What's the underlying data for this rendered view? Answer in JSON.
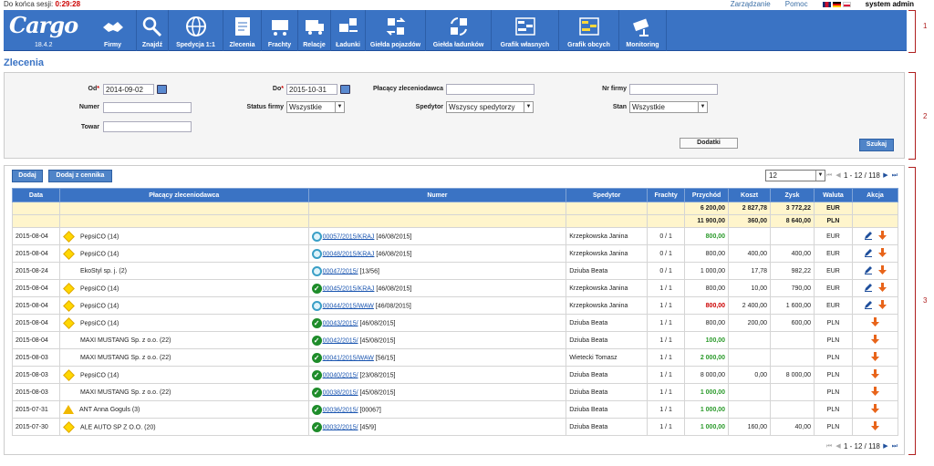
{
  "session": {
    "label": "Do końca sesji:",
    "time": "0:29:28"
  },
  "top_links": {
    "manage": "Zarządzanie",
    "help": "Pomoc",
    "user": "system admin"
  },
  "brand": {
    "name": "Cargo",
    "version": "18.4.2"
  },
  "nav": [
    {
      "label": "Firmy",
      "icon": "handshake-icon"
    },
    {
      "label": "Znajdź",
      "icon": "magnifier-icon"
    },
    {
      "label": "Spedycja 1:1",
      "icon": "globe-icon"
    },
    {
      "label": "Zlecenia",
      "icon": "document-icon"
    },
    {
      "label": "Frachty",
      "icon": "cart-icon"
    },
    {
      "label": "Relacje",
      "icon": "truck-icon"
    },
    {
      "label": "Ładunki",
      "icon": "forklift-icon"
    },
    {
      "label": "Giełda pojazdów",
      "icon": "vehicle-exchange-icon"
    },
    {
      "label": "Giełda ładunków",
      "icon": "cargo-exchange-icon"
    },
    {
      "label": "Grafik własnych",
      "icon": "schedule-icon"
    },
    {
      "label": "Grafik obcych",
      "icon": "schedule-yellow-icon"
    },
    {
      "label": "Monitoring",
      "icon": "camera-icon"
    }
  ],
  "annotations": [
    "1",
    "2",
    "3"
  ],
  "page_title": "Zlecenia",
  "filters": {
    "od_label": "Od",
    "od_value": "2014-09-02",
    "do_label": "Do",
    "do_value": "2015-10-31",
    "platnik_label": "Płacący zleceniodawca",
    "platnik_value": "",
    "nr_firmy_label": "Nr firmy",
    "nr_firmy_value": "",
    "numer_label": "Numer",
    "numer_value": "",
    "status_label": "Status firmy",
    "status_value": "Wszystkie",
    "spedytor_label": "Spedytor",
    "spedytor_value": "Wszyscy spedytorzy",
    "stan_label": "Stan",
    "stan_value": "Wszystkie",
    "towar_label": "Towar",
    "towar_value": "",
    "dodatki": "Dodatki",
    "szukaj": "Szukaj"
  },
  "buttons": {
    "dodaj": "Dodaj",
    "dodaj_cennik": "Dodaj z cennika"
  },
  "pagination": {
    "per_page": "12",
    "range": "1 - 12 / 118"
  },
  "table": {
    "headers": [
      "Data",
      "Płacący zleceniodawca",
      "Numer",
      "Spedytor",
      "Frachty",
      "Przychód",
      "Koszt",
      "Zysk",
      "Waluta",
      "Akcja"
    ],
    "sums": [
      {
        "przychod": "6 200,00",
        "koszt": "2 827,78",
        "zysk": "3 772,22",
        "waluta": "EUR"
      },
      {
        "przychod": "11 900,00",
        "koszt": "360,00",
        "zysk": "8 640,00",
        "waluta": "PLN"
      }
    ],
    "rows": [
      {
        "data": "2015-08-04",
        "flag": "diamond",
        "platnik": "PepsiCO (14)",
        "status": "refresh",
        "numer": "00057/2015/KRAJ",
        "numer_extra": "[46/08/2015]",
        "spedytor": "Krzepkowska Janina",
        "frachty": "0 / 1",
        "przychod": "800,00",
        "przychod_style": "green",
        "koszt": "",
        "zysk": "",
        "waluta": "EUR",
        "edit": true
      },
      {
        "data": "2015-08-04",
        "flag": "diamond",
        "platnik": "PepsiCO (14)",
        "status": "refresh",
        "numer": "00048/2015/KRAJ",
        "numer_extra": "[46/08/2015]",
        "spedytor": "Krzepkowska Janina",
        "frachty": "0 / 1",
        "przychod": "800,00",
        "przychod_style": "",
        "koszt": "400,00",
        "zysk": "400,00",
        "waluta": "EUR",
        "edit": true
      },
      {
        "data": "2015-08-24",
        "flag": "",
        "platnik": "EkoStyl sp. j. (2)",
        "status": "refresh",
        "numer": "00047/2015/",
        "numer_extra": "[13/56]",
        "spedytor": "Dziuba Beata",
        "frachty": "0 / 1",
        "przychod": "1 000,00",
        "przychod_style": "",
        "koszt": "17,78",
        "zysk": "982,22",
        "waluta": "EUR",
        "edit": true
      },
      {
        "data": "2015-08-04",
        "flag": "diamond",
        "platnik": "PepsiCO (14)",
        "status": "check",
        "numer": "00045/2015/KRAJ",
        "numer_extra": "[46/08/2015]",
        "spedytor": "Krzepkowska Janina",
        "frachty": "1 / 1",
        "przychod": "800,00",
        "przychod_style": "",
        "koszt": "10,00",
        "zysk": "790,00",
        "waluta": "EUR",
        "edit": true
      },
      {
        "data": "2015-08-04",
        "flag": "diamond",
        "platnik": "PepsiCO (14)",
        "status": "refresh",
        "numer": "00044/2015/WAW",
        "numer_extra": "[46/08/2015]",
        "spedytor": "Krzepkowska Janina",
        "frachty": "1 / 1",
        "przychod": "800,00",
        "przychod_style": "red",
        "koszt": "2 400,00",
        "zysk": "1 600,00",
        "waluta": "EUR",
        "edit": true
      },
      {
        "data": "2015-08-04",
        "flag": "diamond",
        "platnik": "PepsiCO (14)",
        "status": "check",
        "numer": "00043/2015/",
        "numer_extra": "[46/08/2015]",
        "spedytor": "Dziuba Beata",
        "frachty": "1 / 1",
        "przychod": "800,00",
        "przychod_style": "",
        "koszt": "200,00",
        "zysk": "600,00",
        "waluta": "PLN",
        "edit": false
      },
      {
        "data": "2015-08-04",
        "flag": "",
        "platnik": "MAXI MUSTANG Sp. z o.o. (22)",
        "status": "check",
        "numer": "00042/2015/",
        "numer_extra": "[45/08/2015]",
        "spedytor": "Dziuba Beata",
        "frachty": "1 / 1",
        "przychod": "100,00",
        "przychod_style": "green",
        "koszt": "",
        "zysk": "",
        "waluta": "PLN",
        "edit": false
      },
      {
        "data": "2015-08-03",
        "flag": "",
        "platnik": "MAXI MUSTANG Sp. z o.o. (22)",
        "status": "check",
        "numer": "00041/2015/WAW",
        "numer_extra": "[56/15]",
        "spedytor": "Wietecki Tomasz",
        "frachty": "1 / 1",
        "przychod": "2 000,00",
        "przychod_style": "green",
        "koszt": "",
        "zysk": "",
        "waluta": "PLN",
        "edit": false
      },
      {
        "data": "2015-08-03",
        "flag": "diamond",
        "platnik": "PepsiCO (14)",
        "status": "check",
        "numer": "00040/2015/",
        "numer_extra": "[23/08/2015]",
        "spedytor": "Dziuba Beata",
        "frachty": "1 / 1",
        "przychod": "8 000,00",
        "przychod_style": "",
        "koszt": "0,00",
        "zysk": "8 000,00",
        "waluta": "PLN",
        "edit": false
      },
      {
        "data": "2015-08-03",
        "flag": "",
        "platnik": "MAXI MUSTANG Sp. z o.o. (22)",
        "status": "check",
        "numer": "00038/2015/",
        "numer_extra": "[45/08/2015]",
        "spedytor": "Dziuba Beata",
        "frachty": "1 / 1",
        "przychod": "1 000,00",
        "przychod_style": "green",
        "koszt": "",
        "zysk": "",
        "waluta": "PLN",
        "edit": false
      },
      {
        "data": "2015-07-31",
        "flag": "warn",
        "platnik": "ANT Anna Goguls (3)",
        "status": "check",
        "numer": "00036/2015/",
        "numer_extra": "[00067]",
        "spedytor": "Dziuba Beata",
        "frachty": "1 / 1",
        "przychod": "1 000,00",
        "przychod_style": "green",
        "koszt": "",
        "zysk": "",
        "waluta": "PLN",
        "edit": false
      },
      {
        "data": "2015-07-30",
        "flag": "diamond",
        "platnik": "ALE AUTO SP Z O.O. (20)",
        "status": "check",
        "numer": "00032/2015/",
        "numer_extra": "[45/9]",
        "spedytor": "Dziuba Beata",
        "frachty": "1 / 1",
        "przychod": "1 000,00",
        "przychod_style": "green",
        "koszt": "160,00",
        "zysk": "40,00",
        "waluta": "PLN",
        "edit": false
      }
    ]
  }
}
